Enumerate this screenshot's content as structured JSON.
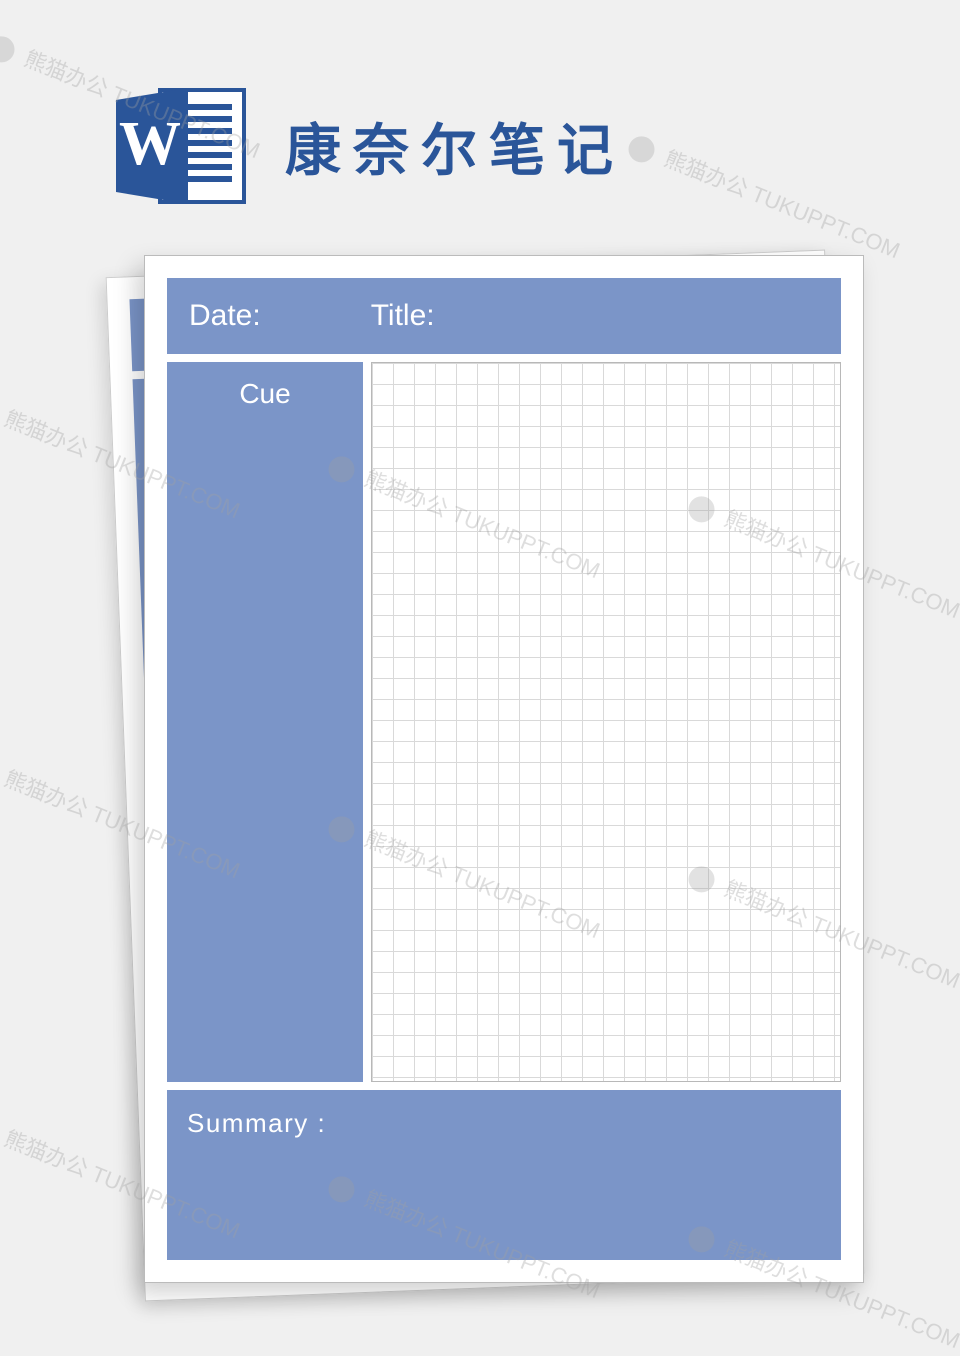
{
  "page_title": "康奈尔笔记",
  "icon": "word-icon",
  "template": {
    "header": {
      "date_label": "Date:",
      "title_label": "Title:"
    },
    "cue_label": "Cue",
    "summary_label": "Summary :"
  },
  "watermark": {
    "brand": "熊猫办公",
    "url": "TUKUPPT.COM"
  },
  "colors": {
    "panel_blue": "#7b95c8",
    "title_blue": "#2a5599",
    "background": "#f0f0f0"
  }
}
